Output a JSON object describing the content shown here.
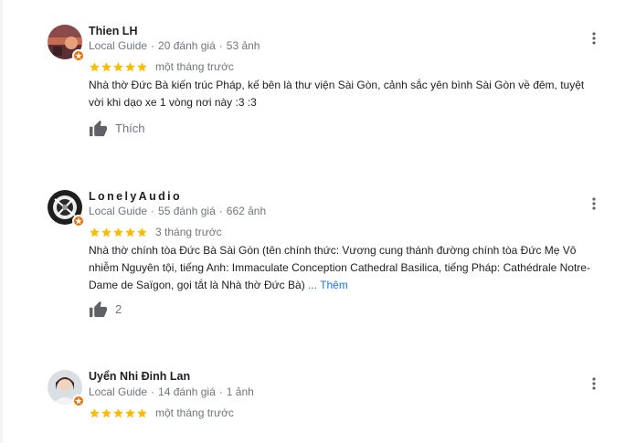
{
  "colors": {
    "star": "#fbbc04",
    "badge": "#e8710a",
    "link": "#1a73e8",
    "secondary": "#70757a"
  },
  "reviews": [
    {
      "name": "Thien LH",
      "guide": "Local Guide",
      "reviews_count": "20 đánh giá",
      "photos_count": "53 ảnh",
      "stars": 5,
      "time": "một tháng trước",
      "text_line1": "Nhà thờ Đức Bà kiến trúc Pháp, kế bên là thư viện Sài Gòn, cảnh sắc yên bình Sài Gòn về đêm, tuyệt",
      "text_line2": "vời khi dạo xe 1 vòng nơi này :3 :3",
      "like_label": "Thích"
    },
    {
      "name": "LonelyAudio",
      "guide": "Local Guide",
      "reviews_count": "55 đánh giá",
      "photos_count": "662 ảnh",
      "stars": 5,
      "time": "3 tháng trước",
      "text_line1": "Nhà thờ chính tòa Đức Bà Sài Gòn (tên chính thức: Vương cung thánh đường chính tòa Đức Mẹ Vô",
      "text_line2": "nhiễm Nguyên tội, tiếng Anh: Immaculate Conception Cathedral Basilica, tiếng Pháp: Cathédrale Notre-",
      "text_line3": "Dame de Saïgon, gọi tắt là Nhà thờ Đức Bà)",
      "more_label": "... Thêm",
      "like_count": "2"
    },
    {
      "name": "Uyển Nhi Đinh Lan",
      "guide": "Local Guide",
      "reviews_count": "14 đánh giá",
      "photos_count": "1 ảnh",
      "stars": 5,
      "time": "một tháng trước"
    }
  ]
}
